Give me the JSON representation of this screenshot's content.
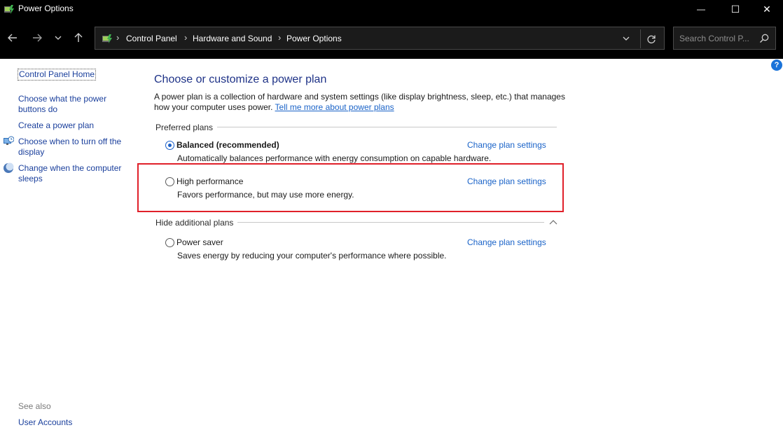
{
  "window": {
    "title": "Power Options",
    "minimize_glyph": "—",
    "maximize_glyph": "☐",
    "close_glyph": "✕"
  },
  "address": {
    "crumbs": [
      "Control Panel",
      "Hardware and Sound",
      "Power Options"
    ],
    "separator": "›",
    "search_placeholder": "Search Control P..."
  },
  "sidebar": {
    "home": "Control Panel Home",
    "links": [
      "Choose what the power buttons do",
      "Create a power plan",
      "Choose when to turn off the display",
      "Change when the computer sleeps"
    ],
    "see_also_label": "See also",
    "see_also_links": [
      "User Accounts"
    ]
  },
  "main": {
    "title": "Choose or customize a power plan",
    "description": "A power plan is a collection of hardware and system settings (like display brightness, sleep, etc.) that manages how your computer uses power.",
    "description_link": "Tell me more about power plans",
    "preferred_label": "Preferred plans",
    "hide_additional_label": "Hide additional plans",
    "change_label": "Change plan settings",
    "plans": [
      {
        "name": "Balanced (recommended)",
        "desc": "Automatically balances performance with energy consumption on capable hardware.",
        "selected": true
      },
      {
        "name": "High performance",
        "desc": "Favors performance, but may use more energy.",
        "selected": false
      },
      {
        "name": "Power saver",
        "desc": "Saves energy by reducing your computer's performance where possible.",
        "selected": false
      }
    ]
  },
  "colors": {
    "link": "#1a63c8",
    "title": "#1e3287",
    "highlight": "#e0202a",
    "chrome": "#000000"
  }
}
